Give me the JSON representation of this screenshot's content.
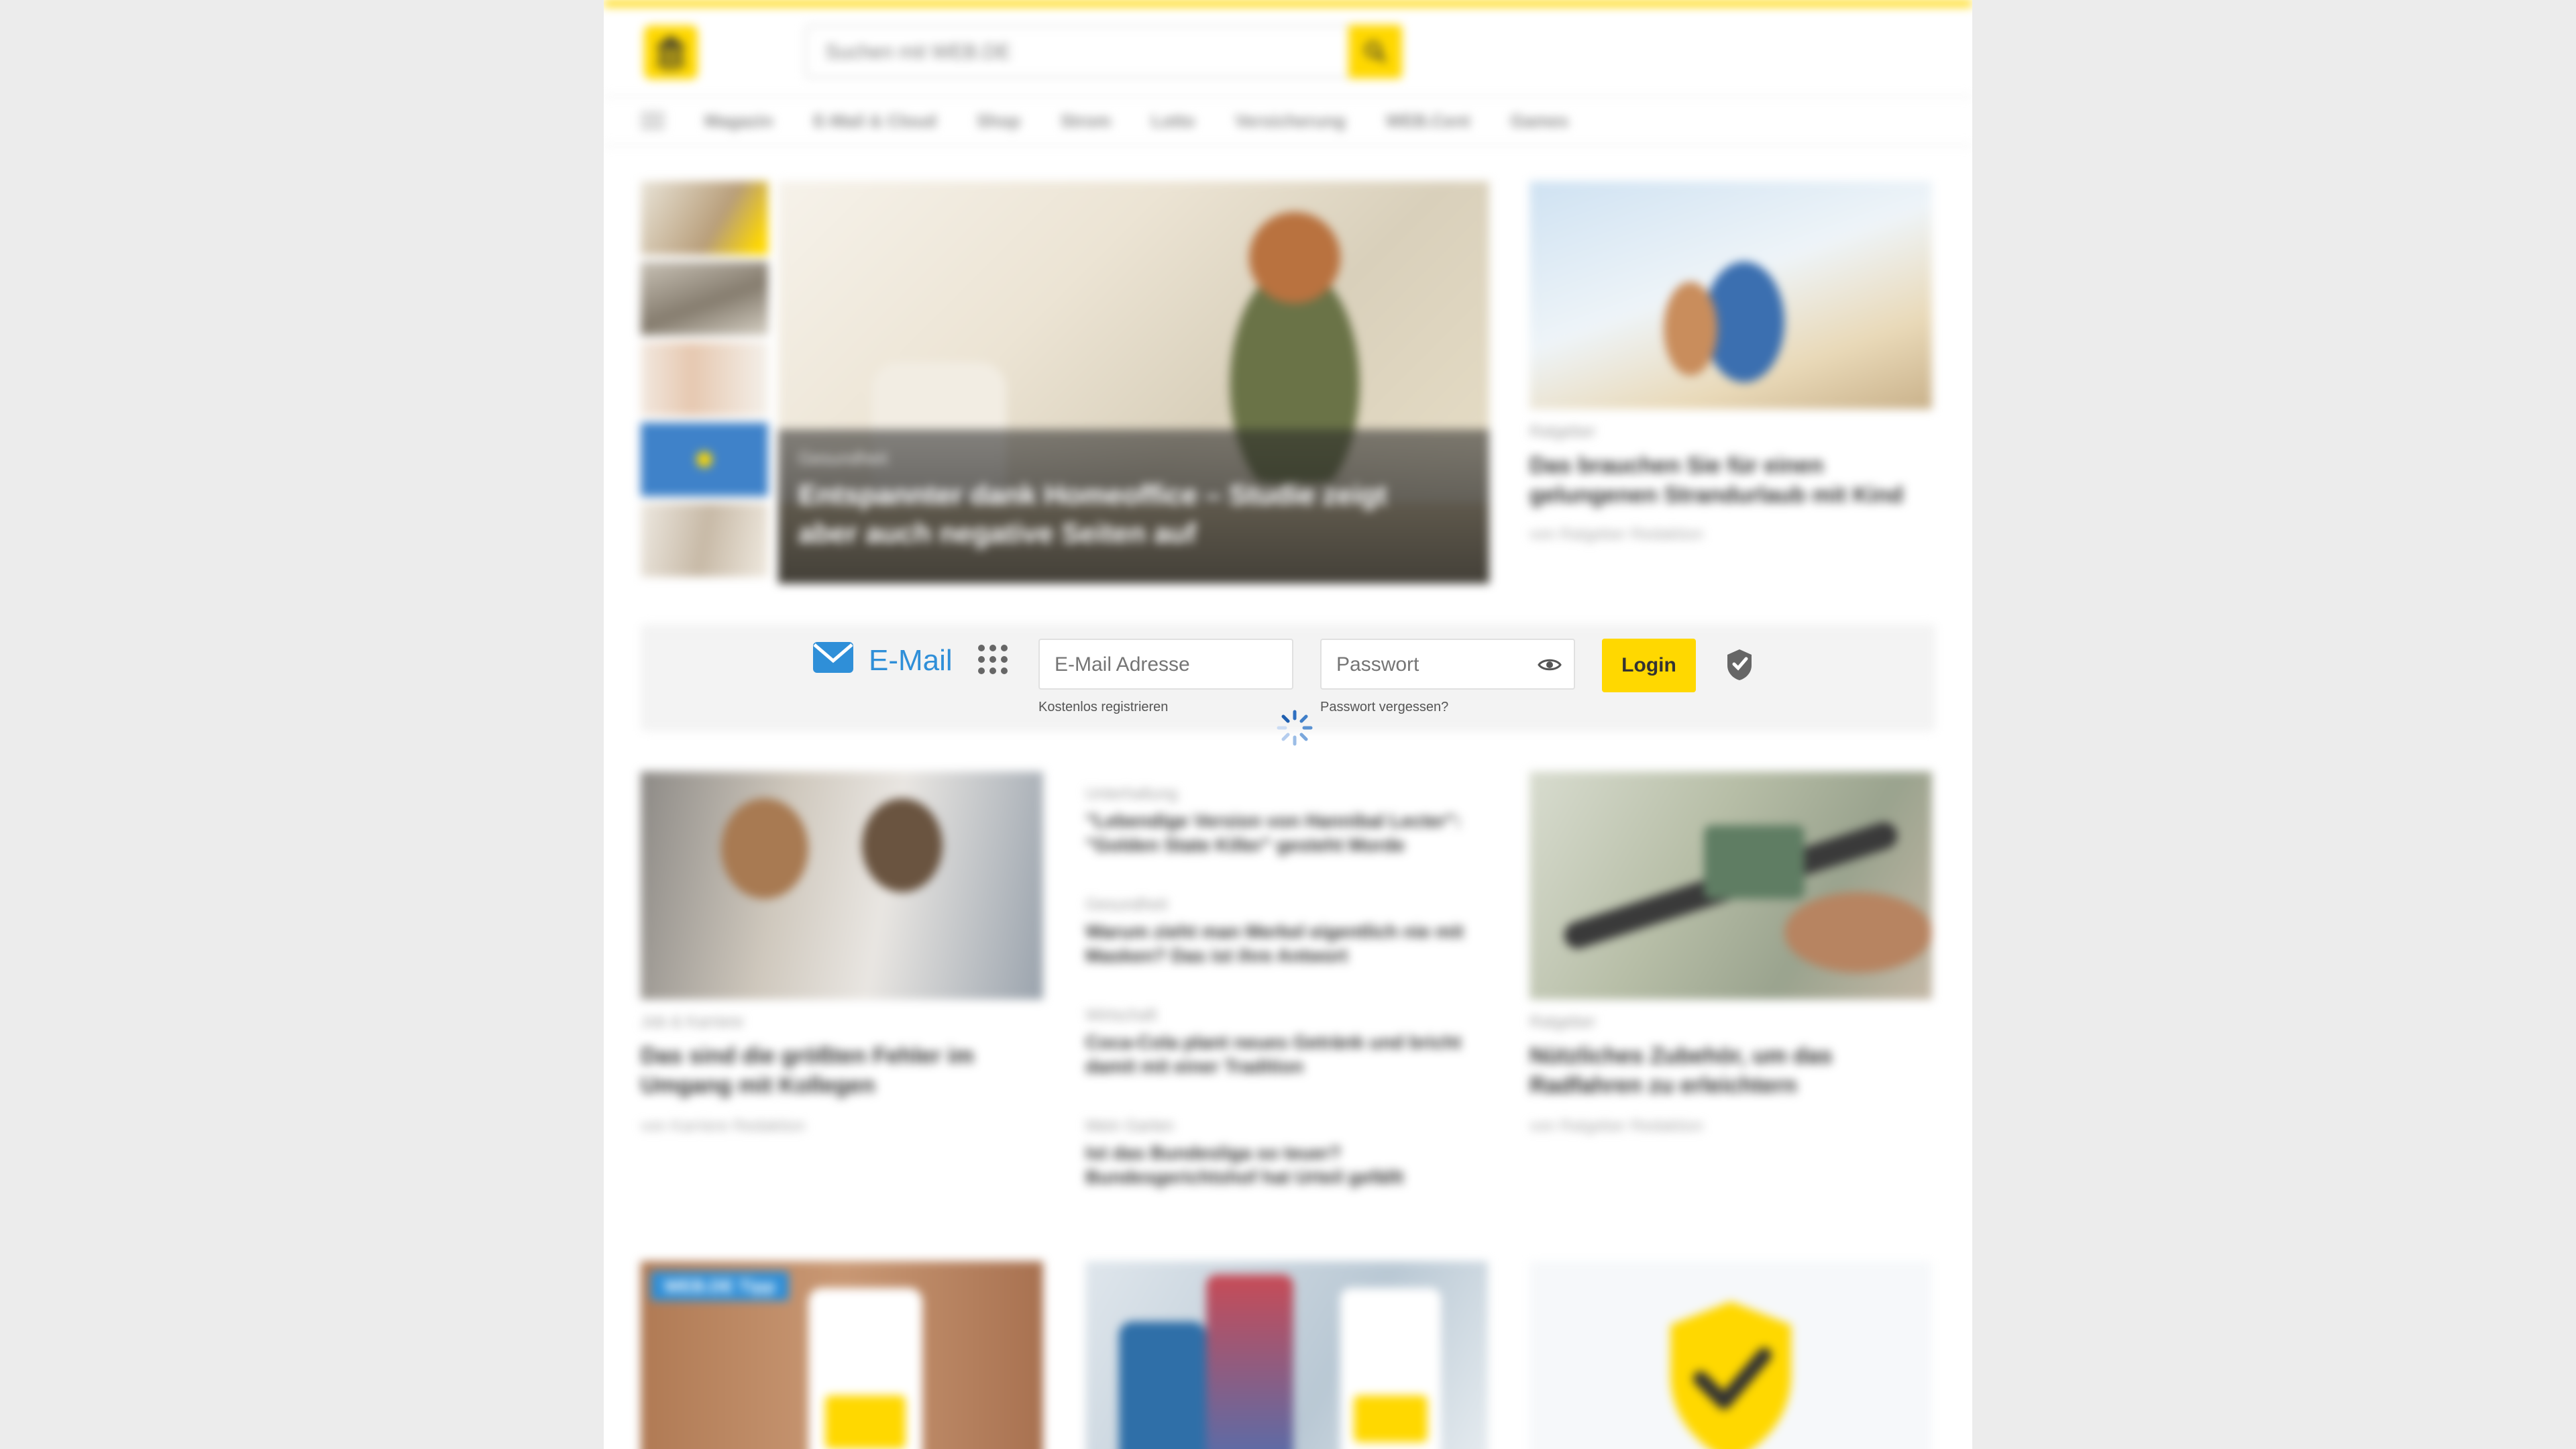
{
  "header": {
    "search_placeholder": "Suchen mit WEB.DE",
    "logo_text": "WEB.DE"
  },
  "nav": {
    "items": [
      "Magazin",
      "E-Mail & Cloud",
      "Shop",
      "Strom",
      "Lotto",
      "Versicherung",
      "WEB.Cent",
      "Games"
    ]
  },
  "hero": {
    "kicker": "Gesundheit",
    "title": "Entspannter dank Homeoffice – Studie zeigt aber auch negative Seiten auf"
  },
  "side_article": {
    "kicker": "Ratgeber",
    "title": "Das brauchen Sie für einen gelungenen Strandurlaub mit Kind",
    "author": "von Ratgeber Redaktion"
  },
  "login": {
    "brand_label": "E-Mail",
    "email_placeholder": "E-Mail Adresse",
    "password_placeholder": "Passwort",
    "login_label": "Login",
    "register_link": "Kostenlos registrieren",
    "forgot_link": "Passwort vergessen?"
  },
  "articles": {
    "left": {
      "kicker": "Job & Karriere",
      "title": "Das sind die größten Fehler im Umgang mit Kollegen",
      "author": "von Karriere Redaktion"
    },
    "middle": [
      {
        "kicker": "Unterhaltung",
        "title": "\"Lebendige Version von Hannibal Lecter\": \"Golden State Killer\" gesteht Morde"
      },
      {
        "kicker": "Gesundheit",
        "title": "Warum zieht man Merkel eigentlich nie mit Masken? Das ist ihre Antwort"
      },
      {
        "kicker": "Wirtschaft",
        "title": "Coca-Cola plant neues Getränk und bricht damit mit einer Tradition"
      },
      {
        "kicker": "Mein Garten",
        "title": "Ist das Bundesliga so teuer? Bundesgerichtshof hat Urteil gefällt"
      }
    ],
    "right": {
      "kicker": "Ratgeber",
      "title": "Nützliches Zubehör, um das Radfahren zu erleichtern",
      "author": "von Ratgeber Redaktion"
    }
  },
  "bottom": {
    "badge": "WEB.DE Tipp"
  },
  "colors": {
    "brand_yellow": "#ffd800",
    "accent_blue": "#2f8fd8",
    "page_bg": "#ececec"
  },
  "icons": [
    "logo-icon",
    "search-icon",
    "menu-icon",
    "mail-icon",
    "apps-grid-icon",
    "eye-icon",
    "shield-icon",
    "loading-spinner-icon"
  ]
}
